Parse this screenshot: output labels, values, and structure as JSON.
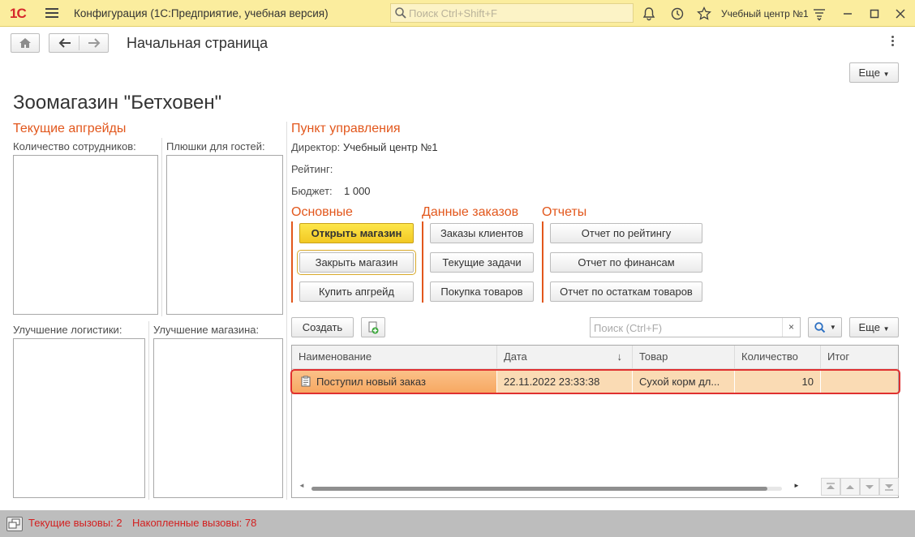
{
  "titlebar": {
    "logo": "1С",
    "title": "Конфигурация  (1С:Предприятие, учебная версия)",
    "search_placeholder": "Поиск Ctrl+Shift+F",
    "user": "Учебный центр №1"
  },
  "nav": {
    "page_title": "Начальная страница",
    "more_label": "Еще"
  },
  "main": {
    "heading": "Зоомагазин \"Бетховен\"",
    "upgrades": {
      "title": "Текущие апгрейды",
      "employees_label": "Количество сотрудников:",
      "buns_label": "Плюшки для гостей:",
      "logistics_label": "Улучшение логистики:",
      "store_label": "Улучшение магазина:"
    },
    "control": {
      "title": "Пункт управления",
      "director_label": "Директор:",
      "director_value": "Учебный центр №1",
      "rating_label": "Рейтинг:",
      "budget_label": "Бюджет:",
      "budget_value": "1 000"
    },
    "groups": {
      "basic": {
        "title": "Основные",
        "open": "Открыть магазин",
        "close": "Закрыть магазин",
        "buy": "Купить апгрейд"
      },
      "orders": {
        "title": "Данные заказов",
        "client_orders": "Заказы клиентов",
        "tasks": "Текущие задачи",
        "purchase": "Покупка товаров"
      },
      "reports": {
        "title": "Отчеты",
        "rating": "Отчет по рейтингу",
        "finance": "Отчет по финансам",
        "stock": "Отчет по остаткам товаров"
      }
    },
    "list": {
      "create_label": "Создать",
      "search_placeholder": "Поиск (Ctrl+F)",
      "clear_glyph": "×",
      "more_label": "Еще",
      "columns": [
        "Наименование",
        "Дата",
        "Товар",
        "Количество",
        "Итог"
      ],
      "rows": [
        {
          "name": "Поступил новый заказ",
          "date": "22.11.2022 23:33:38",
          "product": "Сухой корм дл...",
          "qty": "10",
          "total": ""
        }
      ]
    }
  },
  "status": {
    "current_calls": "Текущие вызовы: 2",
    "accumulated_calls": "Накопленные вызовы: 78"
  },
  "colors": {
    "titlebar": "#fbed9e",
    "accent_orange": "#e2571c",
    "primary_button": "#f2c824",
    "selected_row": "#fadbb4",
    "status_text": "#d31f1f"
  },
  "icons": [
    "burger-menu-icon",
    "search-icon",
    "bell-icon",
    "history-icon",
    "star-icon",
    "settings-icon",
    "minimize-icon",
    "maximize-icon",
    "close-icon",
    "home-icon",
    "back-arrow-icon",
    "forward-arrow-icon",
    "more-vertical-icon",
    "add-copy-icon",
    "document-icon",
    "sort-down-icon",
    "windows-icon"
  ]
}
